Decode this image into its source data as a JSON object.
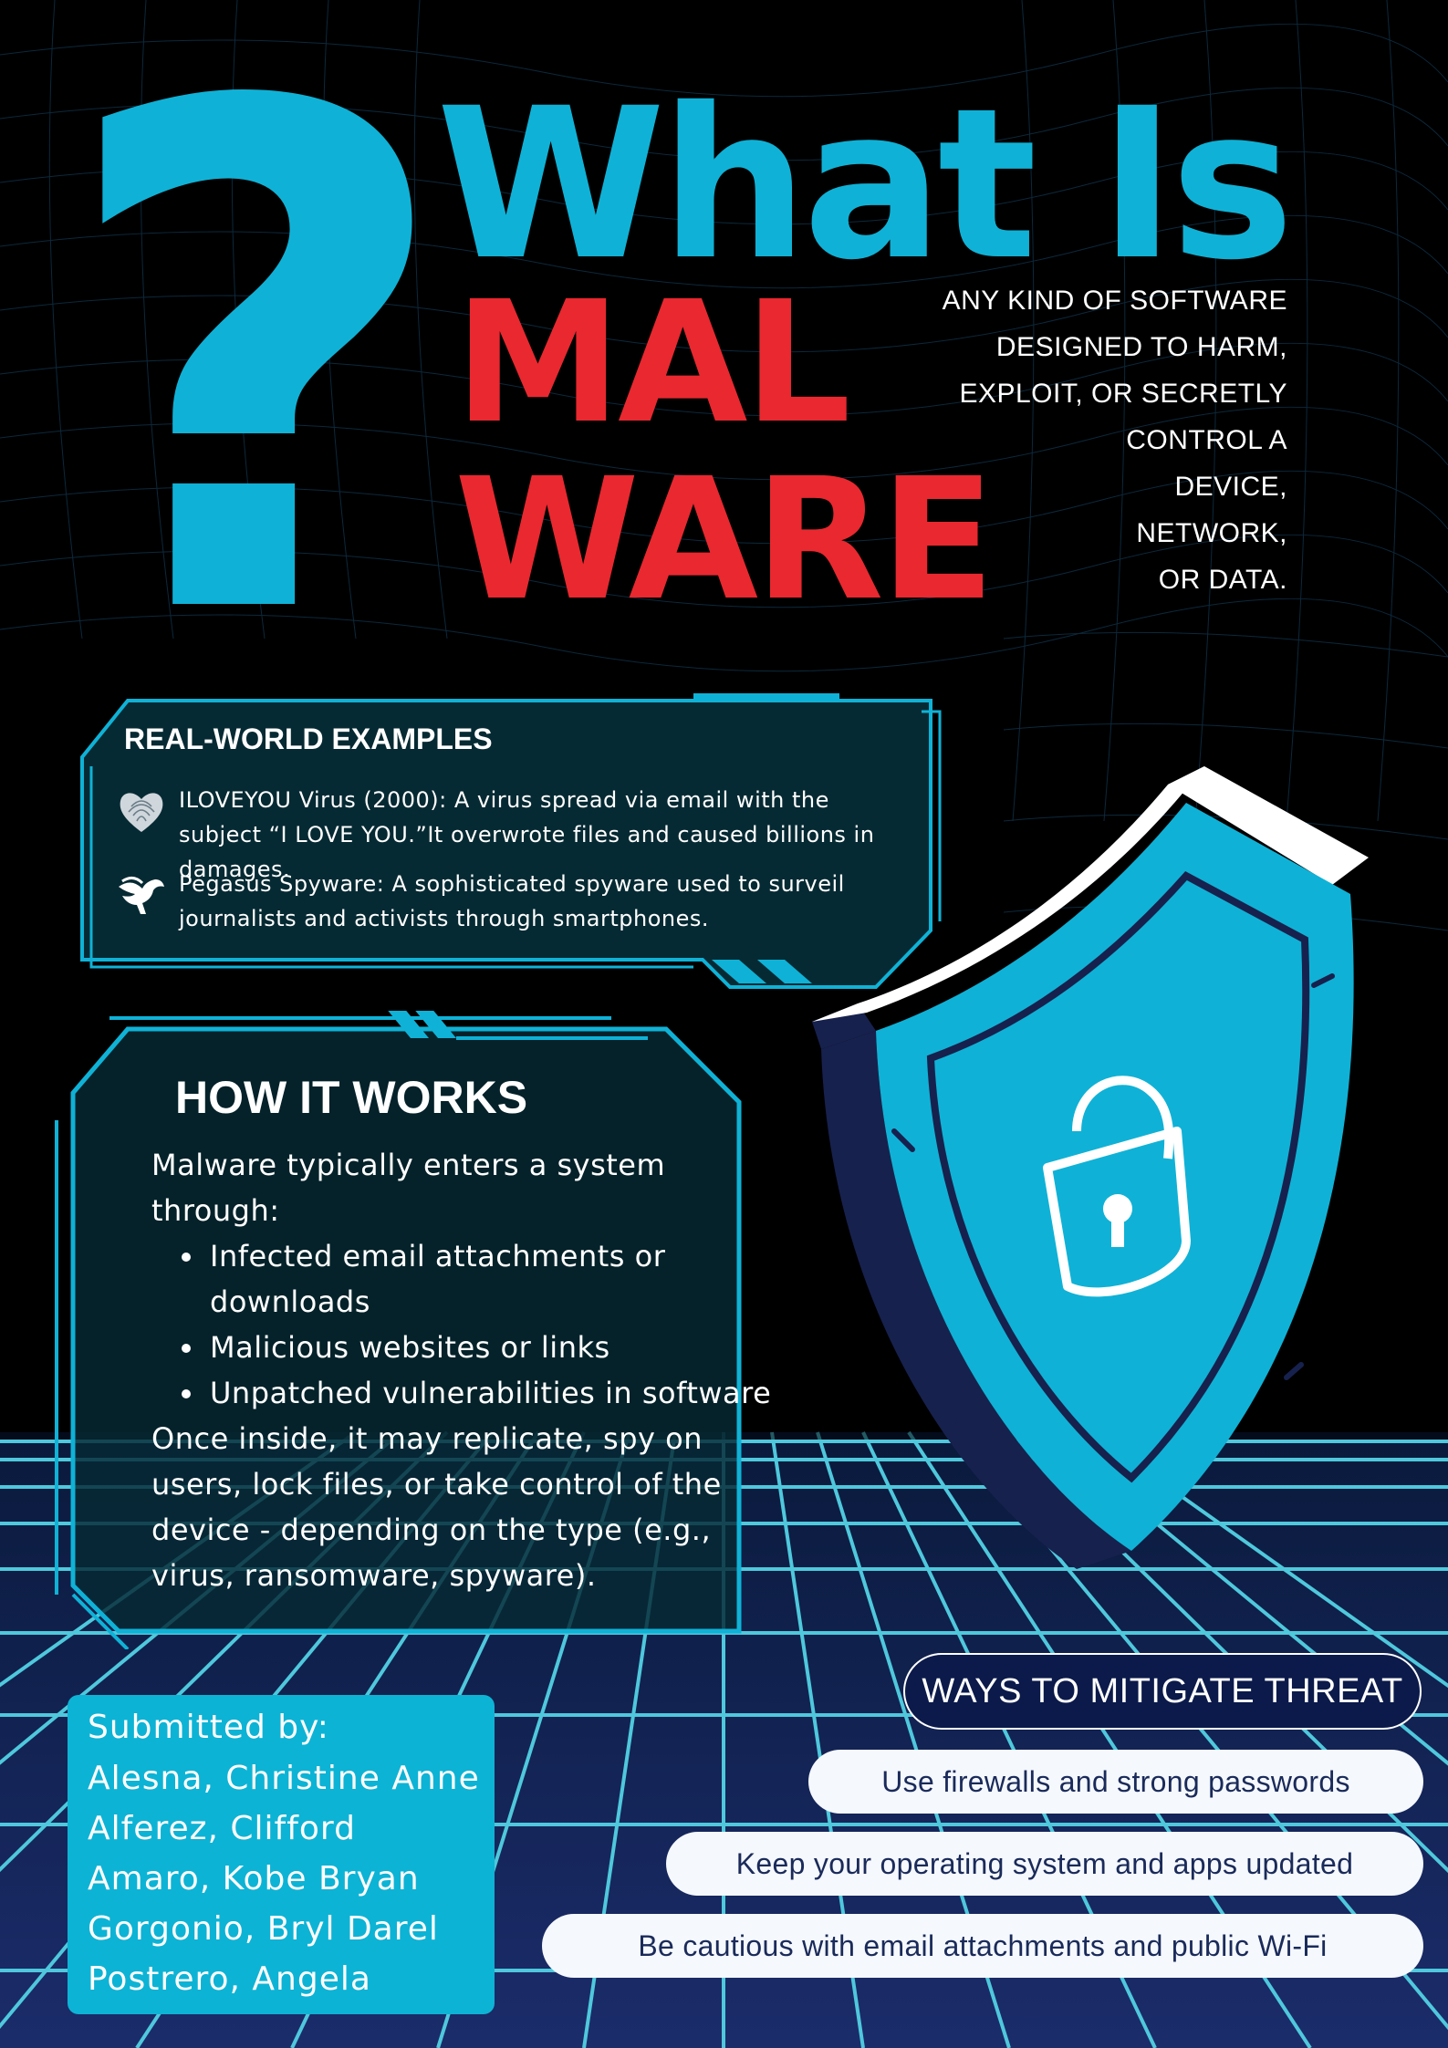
{
  "header": {
    "question_mark": "?",
    "title_line1": "What Is",
    "title_line2": "MAL",
    "title_line3": "WARE"
  },
  "definition": "ANY KIND OF SOFTWARE\nDESIGNED TO HARM,\nEXPLOIT, OR SECRETLY\nCONTROL A\nDEVICE,\nNETWORK,\nOR DATA.",
  "examples": {
    "title": "REAL-WORLD EXAMPLES",
    "items": [
      {
        "icon": "fingerprint-heart-icon",
        "text": "ILOVEYOU Virus (2000): A virus spread via email with the subject “I LOVE YOU.”It overwrote files and caused billions in damages."
      },
      {
        "icon": "pegasus-icon",
        "text": "Pegasus Spyware: A sophisticated spyware used to surveil journalists and activists through smartphones."
      }
    ]
  },
  "how_it_works": {
    "title": "HOW IT WORKS",
    "intro": "Malware typically enters a system through:",
    "bullets": [
      "Infected email attachments or downloads",
      "Malicious websites or links",
      "Unpatched vulnerabilities in software"
    ],
    "outro": "Once inside, it may replicate, spy on users, lock files, or take control of the device - depending on the type (e.g., virus, ransomware, spyware)."
  },
  "submitted": {
    "label": "Submitted by:",
    "names": [
      "Alesna, Christine Anne",
      "Alferez, Clifford",
      "Amaro, Kobe Bryan",
      "Gorgonio, Bryl Darel",
      "Postrero, Angela"
    ]
  },
  "mitigate": {
    "title": "WAYS TO MITIGATE THREAT",
    "items": [
      "Use firewalls and strong passwords",
      "Keep your operating system and apps updated",
      "Be cautious with email attachments and public Wi-Fi"
    ]
  },
  "colors": {
    "background": "#000000",
    "accent_cyan": "#0fb2d6",
    "accent_red": "#e9282f",
    "panel": "#062a33",
    "floor": "#0b1a4a"
  },
  "illustration": {
    "shield": "shield-lock-icon"
  }
}
